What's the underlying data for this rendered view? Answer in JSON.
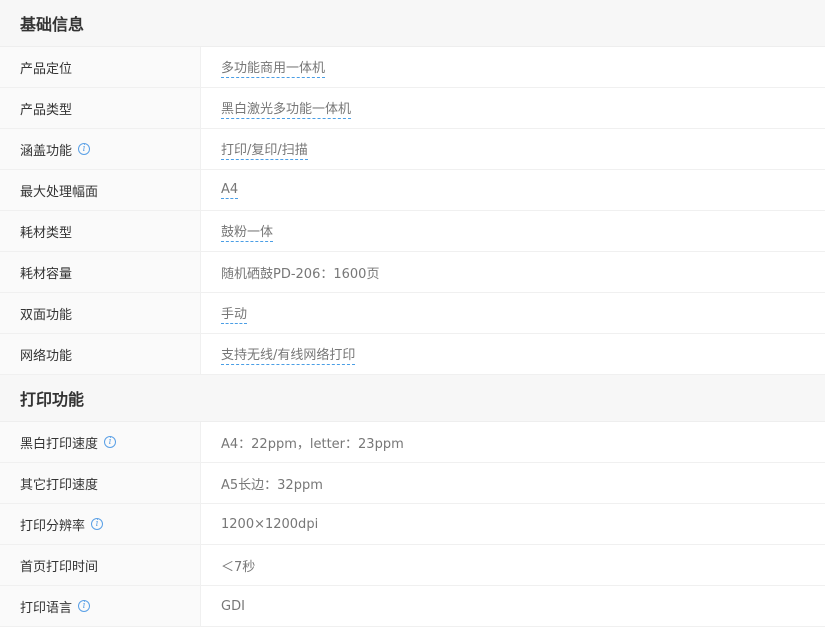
{
  "sections": [
    {
      "title": "基础信息",
      "rows": [
        {
          "label": "产品定位",
          "value": "多功能商用一体机"
        },
        {
          "label": "产品类型",
          "value": "黑白激光多功能一体机"
        },
        {
          "label": "涵盖功能",
          "value": "打印/复印/扫描",
          "info_icon": "i"
        },
        {
          "label": "最大处理幅面",
          "value": "A4"
        },
        {
          "label": "耗材类型",
          "value": "鼓粉一体"
        },
        {
          "label": "耗材容量",
          "value": "随机硒鼓PD-206：1600页"
        },
        {
          "label": "双面功能",
          "value": "手动"
        },
        {
          "label": "网络功能",
          "value": "支持无线/有线网络打印"
        }
      ]
    },
    {
      "title": "打印功能",
      "rows": [
        {
          "label": "黑白打印速度",
          "value": "A4：22ppm，letter：23ppm",
          "info_icon": "i"
        },
        {
          "label": "其它打印速度",
          "value": "A5长边：32ppm"
        },
        {
          "label": "打印分辨率",
          "value": "1200×1200dpi",
          "info_icon": "i"
        },
        {
          "label": "首页打印时间",
          "value": "＜7秒"
        },
        {
          "label": "打印语言",
          "value": "GDI",
          "info_icon": "i"
        }
      ]
    }
  ]
}
